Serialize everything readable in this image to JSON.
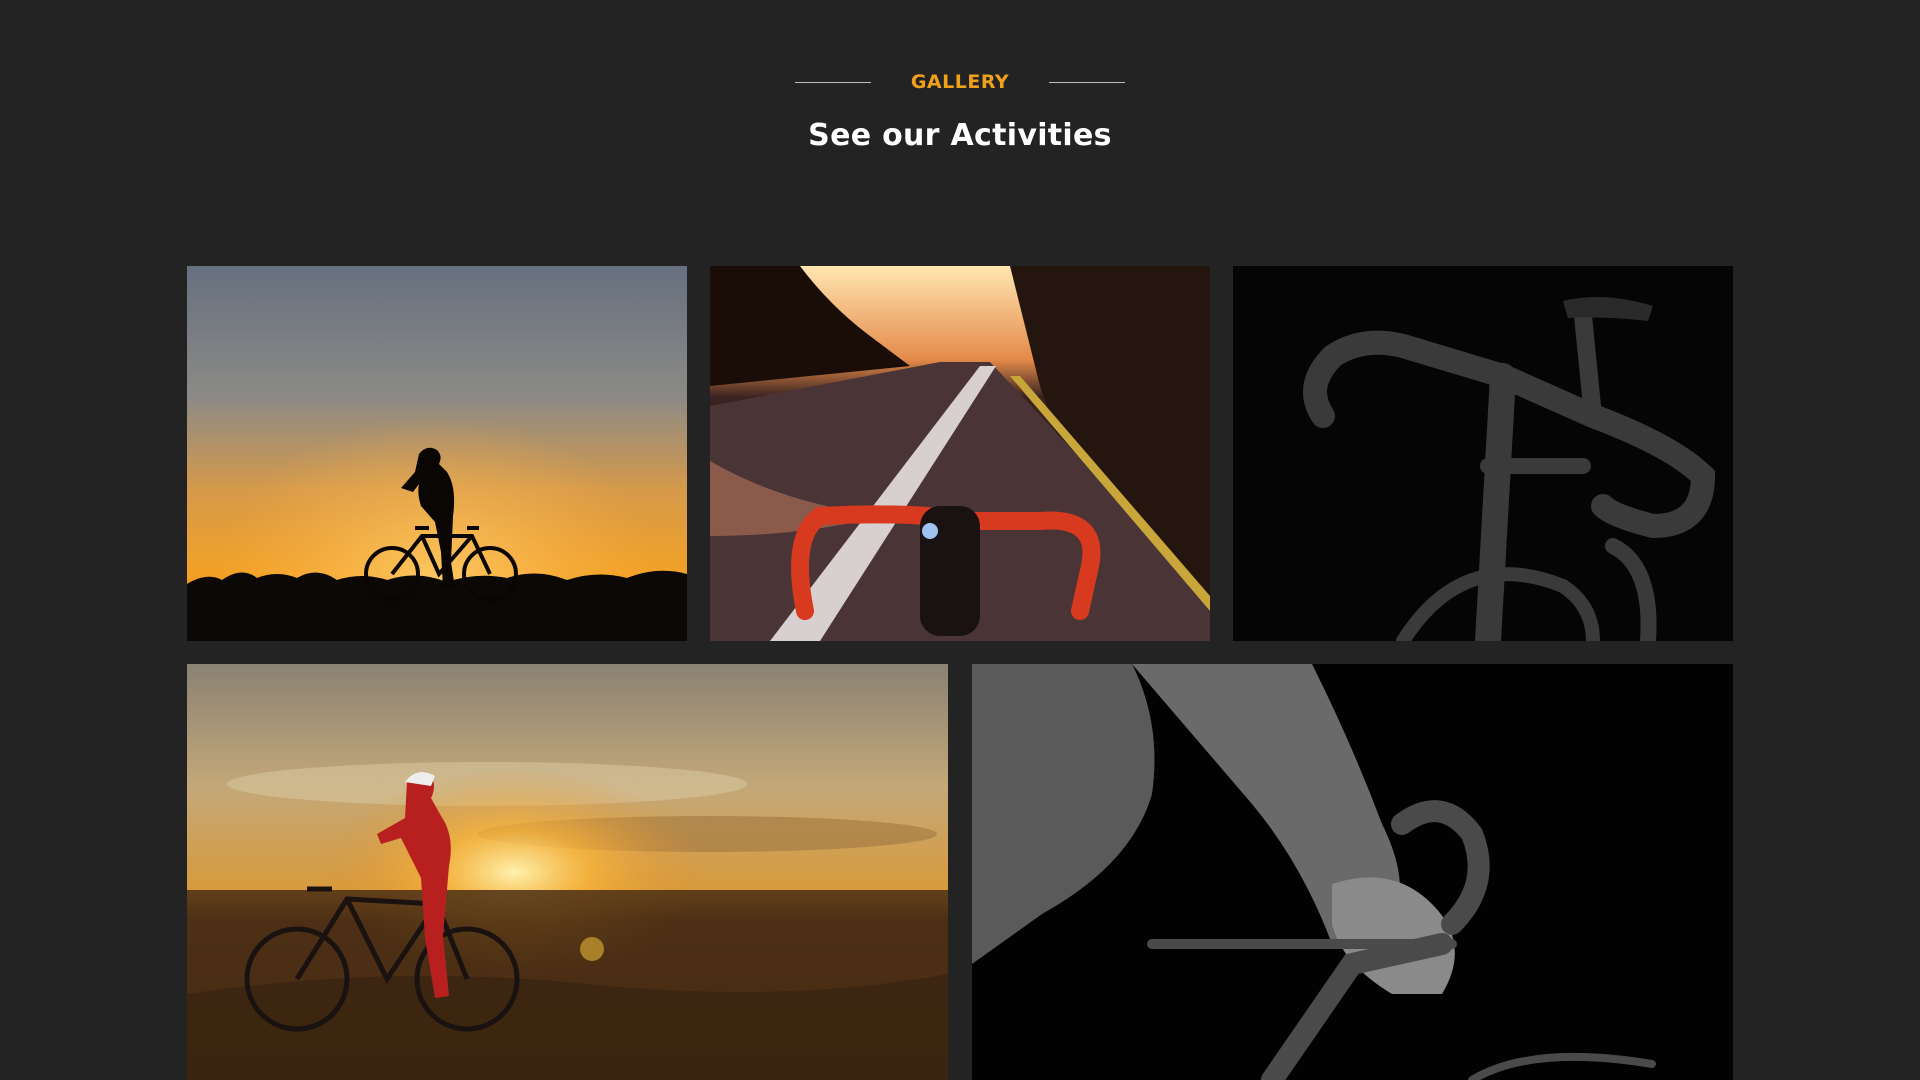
{
  "section": {
    "eyebrow": "GALLERY",
    "heading": "See our Activities"
  },
  "colors": {
    "background": "#232323",
    "accent": "#f0a11a",
    "heading": "#ffffff"
  },
  "gallery": {
    "tiles": [
      {
        "subject": "cyclist-silhouette-sunset"
      },
      {
        "subject": "handlebar-road-pov"
      },
      {
        "subject": "road-bike-dark-studio"
      },
      {
        "subject": "cyclist-drinking-sunset-field"
      },
      {
        "subject": "cyclist-arms-handlebar-bw"
      }
    ]
  }
}
